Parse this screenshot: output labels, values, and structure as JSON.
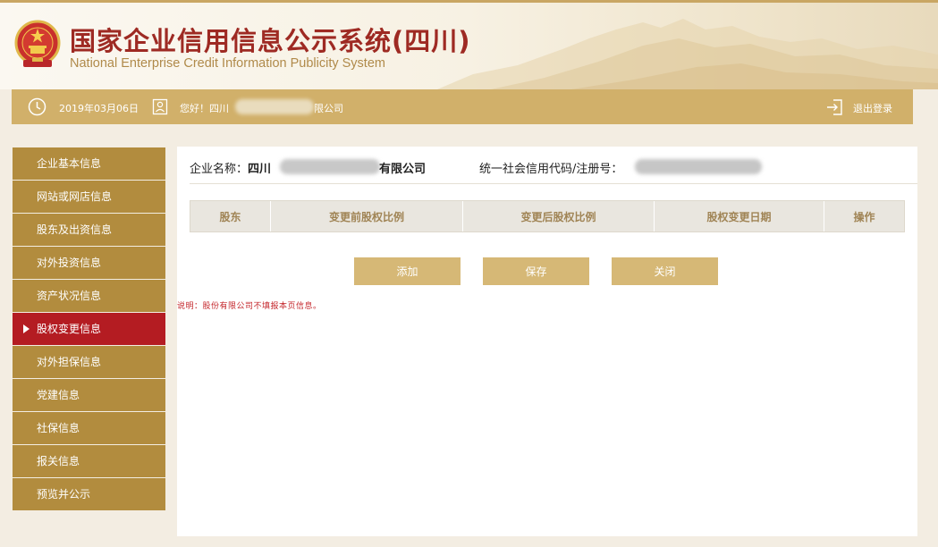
{
  "header": {
    "title_cn": "国家企业信用信息公示系统(四川)",
    "title_en": "National Enterprise Credit Information Publicity System"
  },
  "infobar": {
    "date": "2019年03月06日",
    "greeting_prefix": "您好！四川",
    "greeting_suffix": "限公司",
    "logout": "退出登录"
  },
  "sidebar": {
    "items": [
      {
        "label": "企业基本信息",
        "active": false
      },
      {
        "label": "网站或网店信息",
        "active": false
      },
      {
        "label": "股东及出资信息",
        "active": false
      },
      {
        "label": "对外投资信息",
        "active": false
      },
      {
        "label": "资产状况信息",
        "active": false
      },
      {
        "label": "股权变更信息",
        "active": true
      },
      {
        "label": "对外担保信息",
        "active": false
      },
      {
        "label": "党建信息",
        "active": false
      },
      {
        "label": "社保信息",
        "active": false
      },
      {
        "label": "报关信息",
        "active": false
      },
      {
        "label": "预览并公示",
        "active": false
      }
    ]
  },
  "main": {
    "company_label": "企业名称：",
    "company_prefix": "四川",
    "company_suffix": "有限公司",
    "code_label": "统一社会信用代码/注册号：",
    "table": {
      "columns": [
        "股东",
        "变更前股权比例",
        "变更后股权比例",
        "股权变更日期",
        "操作"
      ]
    },
    "buttons": {
      "add": "添加",
      "save": "保存",
      "close": "关闭"
    },
    "note": "说明：股份有限公司不填报本页信息。"
  },
  "colors": {
    "brand_red": "#9e2a23",
    "gold": "#d1b06a",
    "sidebar_gold": "#b28c3e",
    "active_red": "#b41c22"
  }
}
